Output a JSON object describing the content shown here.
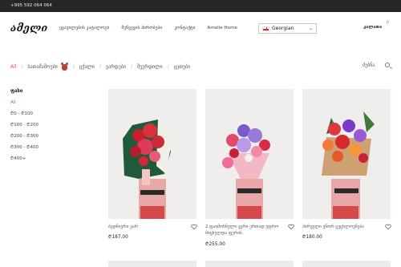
{
  "topbar": {
    "phone": "+995 592 064 064"
  },
  "header": {
    "logo": "ამელი",
    "nav": [
      {
        "label": "ყვავილების კატალოგი"
      },
      {
        "label": "მეწვევის პირობები"
      },
      {
        "label": "კონტაქტი"
      },
      {
        "label": "Amelie Home"
      }
    ],
    "language": {
      "selected": "Georgian"
    },
    "cart": {
      "label": "კალათა",
      "count": "0"
    }
  },
  "filters": {
    "all": "All",
    "items": [
      {
        "label": "სათამაშოები"
      },
      {
        "label": "ცქალი"
      },
      {
        "label": "ვარდები"
      },
      {
        "label": "შეურდილი"
      },
      {
        "label": "ცეთები"
      }
    ],
    "search": "ძებნა"
  },
  "sidebar": {
    "title": "ფასი",
    "options": [
      {
        "label": "All",
        "active": true
      },
      {
        "label": "₾0 - ₾100"
      },
      {
        "label": "₾100 - ₾200"
      },
      {
        "label": "₾200 - ₾300"
      },
      {
        "label": "₾300 - ₾400"
      },
      {
        "label": "₾400+"
      }
    ]
  },
  "products": [
    {
      "name": "ბედნიერი ვარ",
      "price": "₾187.00"
    },
    {
      "name": "2 ფაიმოხნული ვერი ერთად უფრო მიცხელდა ფერის",
      "price": "₾255.00"
    },
    {
      "name": "პირველი ვნორ ცეცხლოვნება",
      "price": "₾180.00"
    }
  ],
  "colors": {
    "accent": "#e24a56",
    "topbar": "#262626"
  }
}
